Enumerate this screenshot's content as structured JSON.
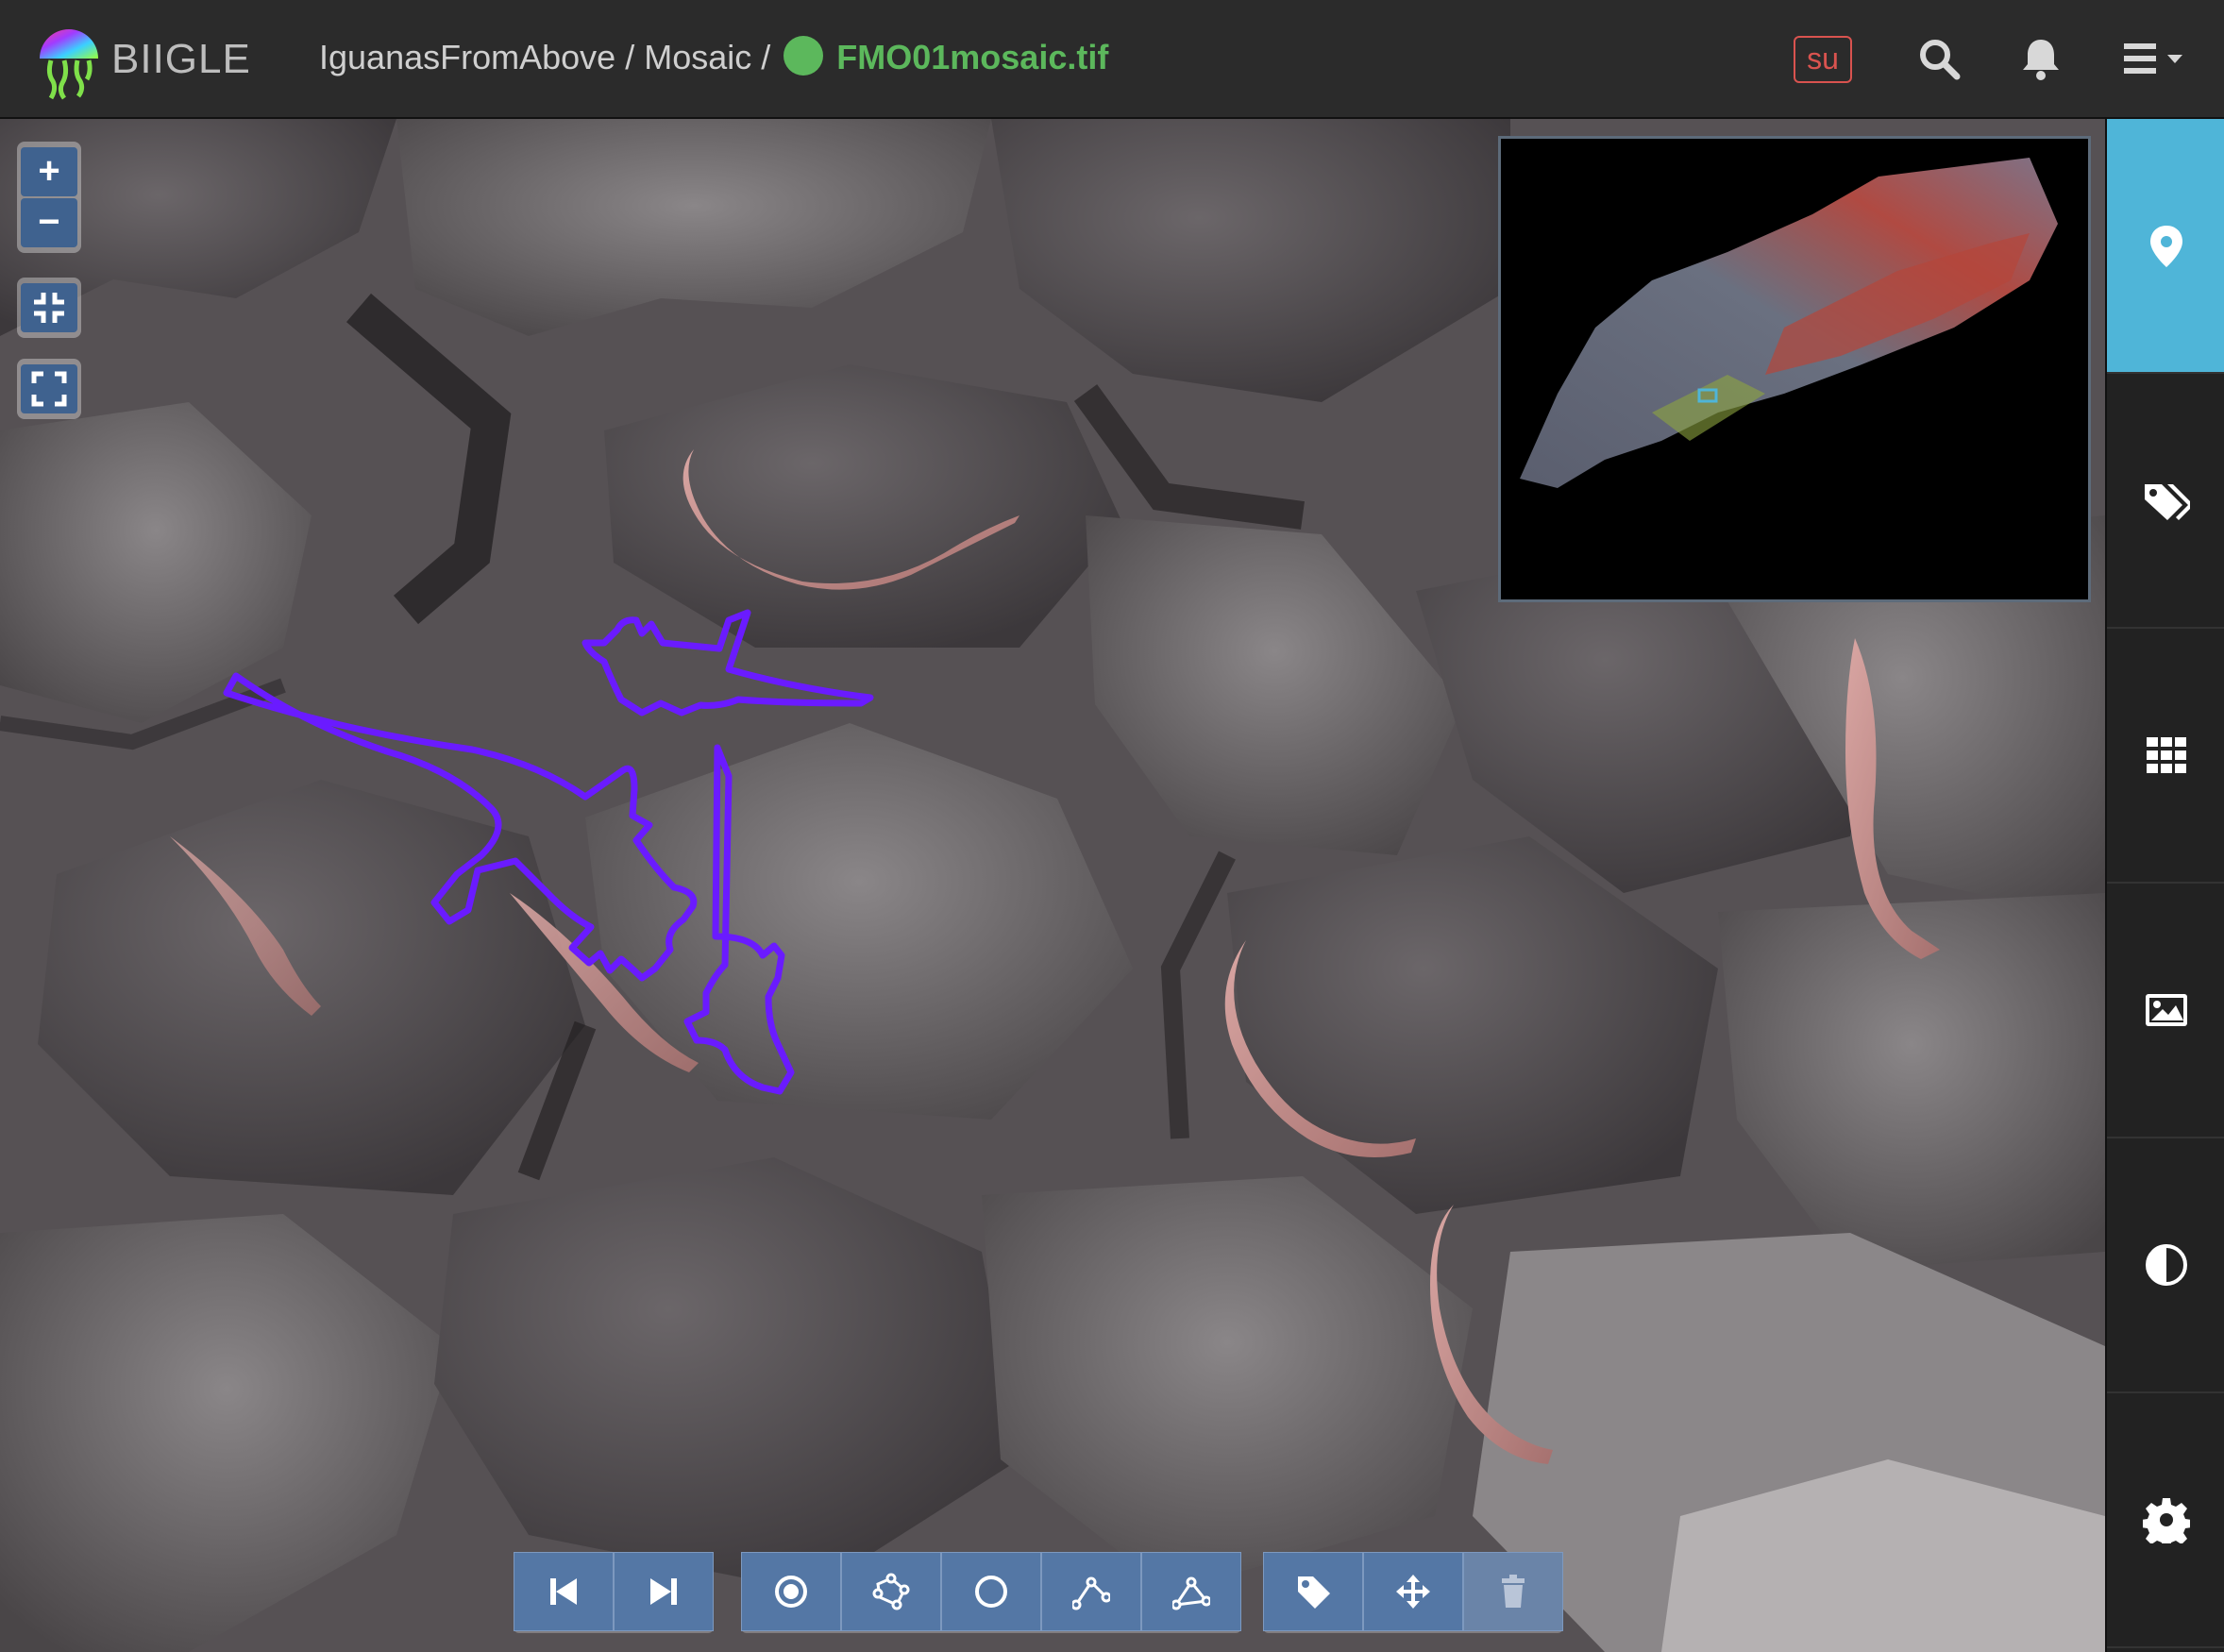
{
  "app": {
    "brand": "BIIGLE"
  },
  "breadcrumb": {
    "project": "IguanasFromAbove",
    "volume": "Mosaic",
    "separator": "/",
    "file": "FMO01mosaic.tif"
  },
  "header": {
    "su_badge": "su"
  },
  "icons": {
    "search": "search-icon",
    "bell": "bell-icon",
    "menu": "menu-icon",
    "sidebar": [
      "map-marker-icon",
      "tags-icon",
      "grid-icon",
      "image-icon",
      "contrast-icon",
      "gear-icon"
    ]
  },
  "zoom": {
    "in": "+",
    "out": "−"
  },
  "toolbar": {
    "nav": [
      "previous-image",
      "next-image"
    ],
    "draw": [
      "point",
      "rectangle",
      "circle",
      "linestring",
      "polygon"
    ],
    "edit": [
      "attach-label",
      "move",
      "delete"
    ]
  },
  "colors": {
    "accent": "#4fb5d8",
    "annotation": "#6a1bff",
    "file_status": "#5cb85c",
    "su_badge": "#d9534f",
    "tool": "#5477a5"
  }
}
